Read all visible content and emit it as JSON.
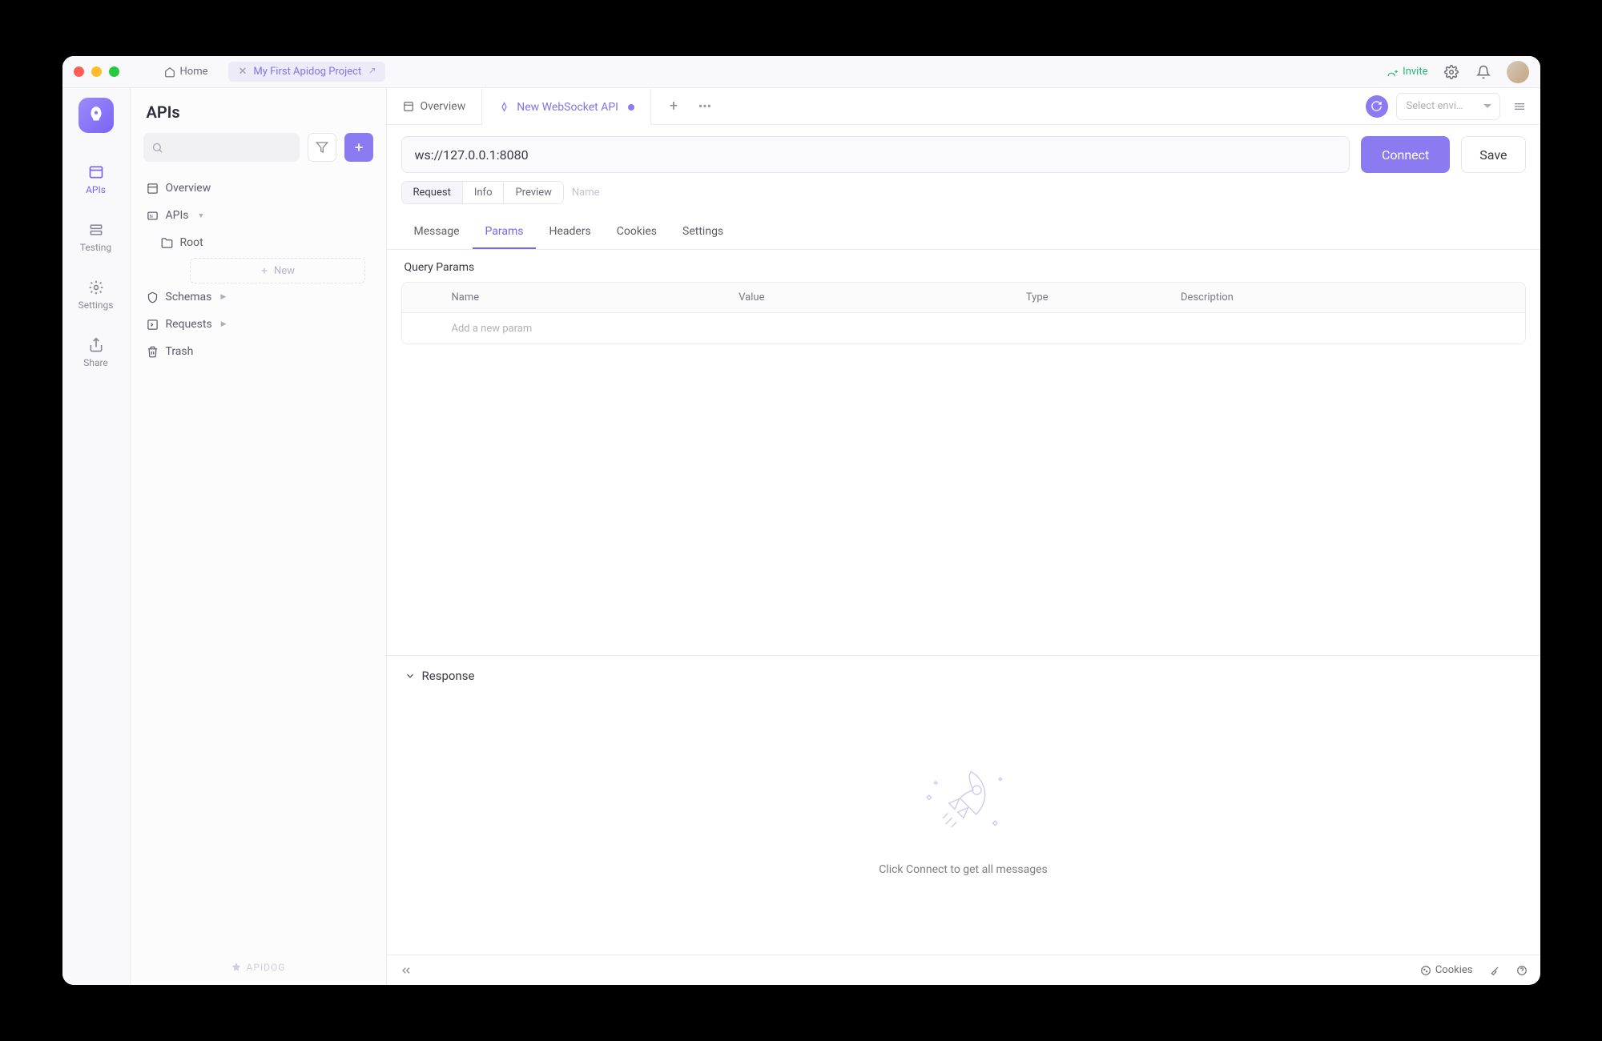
{
  "titlebar": {
    "home": "Home",
    "project_tab": "My First Apidog Project",
    "invite": "Invite"
  },
  "nav": {
    "items": [
      "APIs",
      "Testing",
      "Settings",
      "Share"
    ]
  },
  "sidebar": {
    "title": "APIs",
    "tree": {
      "overview": "Overview",
      "apis": "APIs",
      "root": "Root",
      "new": "New",
      "schemas": "Schemas",
      "requests": "Requests",
      "trash": "Trash"
    },
    "footer": "APIDOG"
  },
  "tabs": {
    "overview": "Overview",
    "current": "New WebSocket API",
    "env_placeholder": "Select envi…"
  },
  "request": {
    "url": "ws://127.0.0.1:8080",
    "connect": "Connect",
    "save": "Save",
    "pills": {
      "request": "Request",
      "info": "Info",
      "preview": "Preview"
    },
    "name_placeholder": "Name",
    "subtabs": {
      "message": "Message",
      "params": "Params",
      "headers": "Headers",
      "cookies": "Cookies",
      "settings": "Settings"
    },
    "query_params_label": "Query Params",
    "columns": {
      "name": "Name",
      "value": "Value",
      "type": "Type",
      "description": "Description"
    },
    "add_param": "Add a new param"
  },
  "response": {
    "title": "Response",
    "empty": "Click Connect to get all messages"
  },
  "statusbar": {
    "cookies": "Cookies"
  }
}
